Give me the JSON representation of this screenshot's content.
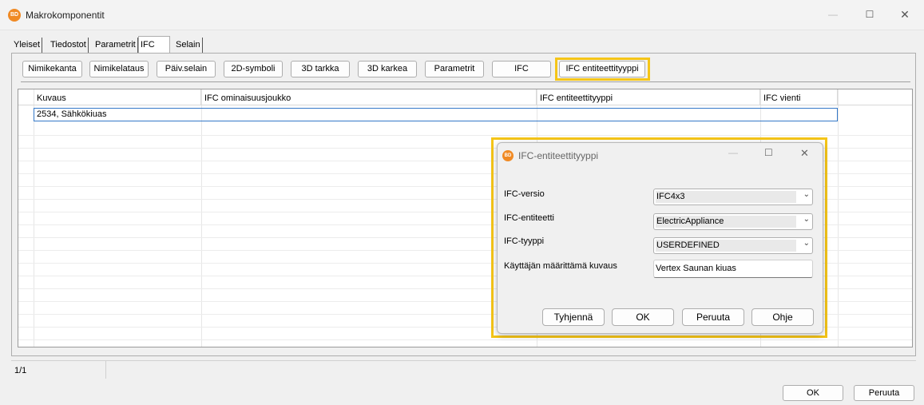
{
  "window": {
    "icon_text": "BD",
    "title": "Makrokomponentit",
    "minimize": "—",
    "maximize": "☐",
    "close": "✕"
  },
  "tabs": [
    "Yleiset",
    "Tiedostot",
    "Parametrit",
    "IFC",
    "Selain"
  ],
  "toolbar": [
    "Nimikekanta",
    "Nimikelataus",
    "Päiv.selain",
    "2D-symboli",
    "3D tarkka",
    "3D karkea",
    "Parametrit",
    "IFC",
    "IFC entiteettityyppi"
  ],
  "grid": {
    "columns": [
      "Kuvaus",
      "IFC ominaisuusjoukko",
      "IFC entiteettityyppi",
      "IFC vienti"
    ],
    "rows": [
      [
        "2534, Sähkökiuas",
        "",
        "",
        ""
      ]
    ]
  },
  "status": {
    "page": "1/1"
  },
  "footer": {
    "ok": "OK",
    "cancel": "Peruuta"
  },
  "dialog": {
    "icon_text": "BD",
    "title": "IFC-entiteettityyppi",
    "minimize": "—",
    "maximize": "☐",
    "close": "✕",
    "fields": {
      "version_label": "IFC-versio",
      "version_value": "IFC4x3",
      "entity_label": "IFC-entiteetti",
      "entity_value": "ElectricAppliance",
      "type_label": "IFC-tyyppi",
      "type_value": "USERDEFINED",
      "desc_label": "Käyttäjän määrittämä kuvaus",
      "desc_value": "Vertex Saunan kiuas"
    },
    "buttons": {
      "clear": "Tyhjennä",
      "ok": "OK",
      "cancel": "Peruuta",
      "help": "Ohje"
    }
  },
  "colors": {
    "highlight": "#f5c518",
    "selection": "#3478c8",
    "app_icon": "#f08a24"
  }
}
